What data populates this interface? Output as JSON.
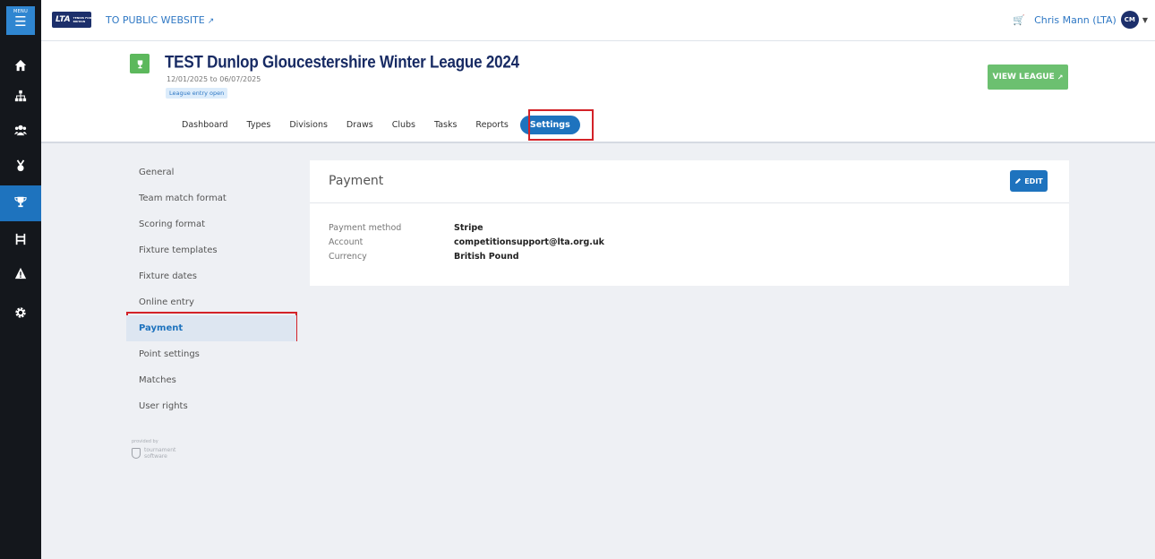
{
  "rail": {
    "menu_label": "MENU",
    "items": [
      {
        "icon": "home-icon"
      },
      {
        "icon": "sitemap-icon"
      },
      {
        "icon": "users-icon"
      },
      {
        "icon": "medal-icon"
      },
      {
        "icon": "trophy-icon",
        "active": true
      },
      {
        "icon": "draws-bracket-icon"
      },
      {
        "icon": "warning-icon"
      },
      {
        "icon": "gear-icon"
      }
    ]
  },
  "topbar": {
    "logo_text": "LTA",
    "logo_subtext": "TENNIS FOR BRITAIN",
    "public_link": "TO PUBLIC WEBSITE",
    "user_name": "Chris Mann (LTA)",
    "user_initials": "CM"
  },
  "league": {
    "title": "TEST Dunlop Gloucestershire Winter League 2024",
    "dates": "12/01/2025 to 06/07/2025",
    "badge": "League entry open",
    "view_button": "VIEW LEAGUE",
    "tabs": [
      "Dashboard",
      "Types",
      "Divisions",
      "Draws",
      "Clubs",
      "Tasks",
      "Reports",
      "Settings"
    ],
    "active_tab": "Settings"
  },
  "settings_nav": {
    "items": [
      "General",
      "Team match format",
      "Scoring format",
      "Fixture templates",
      "Fixture dates",
      "Online entry",
      "Payment",
      "Point settings",
      "Matches",
      "User rights"
    ],
    "active": "Payment"
  },
  "powered_by": {
    "label": "provided by",
    "brand_line1": "tournament",
    "brand_line2": "software"
  },
  "payment": {
    "title": "Payment",
    "edit_button": "EDIT",
    "rows": [
      {
        "label": "Payment method",
        "value": "Stripe"
      },
      {
        "label": "Account",
        "value": "competitionsupport@lta.org.uk"
      },
      {
        "label": "Currency",
        "value": "British Pound"
      }
    ]
  },
  "colors": {
    "primary": "#1e73be",
    "success": "#6cc070",
    "highlight": "#d32228",
    "rail": "#14171c",
    "title": "#172a63"
  }
}
